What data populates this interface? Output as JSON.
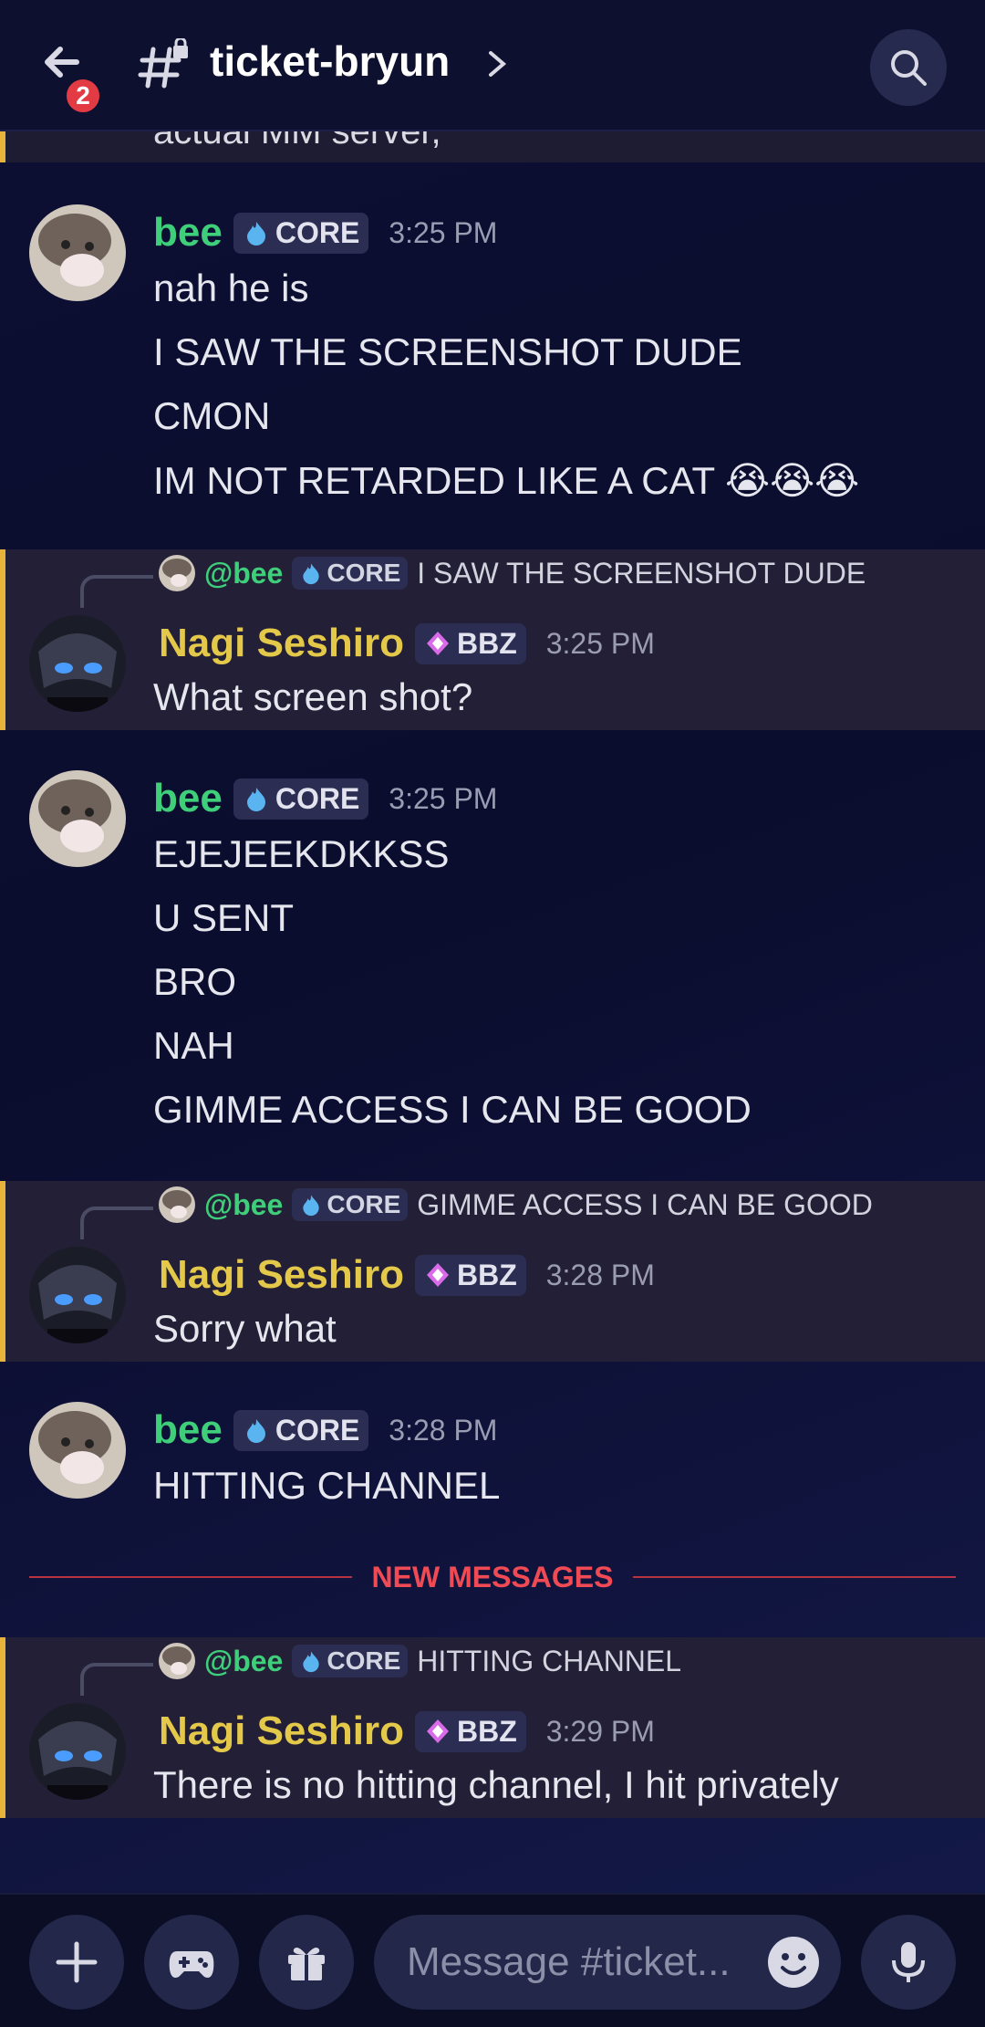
{
  "header": {
    "notif_count": "2",
    "channel_name": "ticket-bryun"
  },
  "cut_message": {
    "text": "actual MM server,"
  },
  "messages": [
    {
      "author": "bee",
      "tag": "CORE",
      "time": "3:25 PM",
      "lines": [
        "nah he is",
        "I SAW THE SCREENSHOT DUDE",
        "CMON",
        "IM NOT RETARDED LIKE A CAT 😭😭😭"
      ]
    },
    {
      "reply": {
        "mention": "@bee",
        "tag": "CORE",
        "text": "I SAW THE SCREENSHOT DUDE"
      },
      "author": "Nagi Seshiro",
      "tag": "BBZ",
      "time": "3:25 PM",
      "lines": [
        "What screen shot?"
      ]
    },
    {
      "author": "bee",
      "tag": "CORE",
      "time": "3:25 PM",
      "lines": [
        "EJEJEEKDKKSS",
        "U SENT",
        "BRO",
        "NAH",
        "GIMME ACCESS I CAN BE GOOD"
      ]
    },
    {
      "reply": {
        "mention": "@bee",
        "tag": "CORE",
        "text": "GIMME ACCESS I CAN BE GOOD"
      },
      "author": "Nagi Seshiro",
      "tag": "BBZ",
      "time": "3:28 PM",
      "lines": [
        "Sorry what"
      ]
    },
    {
      "author": "bee",
      "tag": "CORE",
      "time": "3:28 PM",
      "lines": [
        "HITTING CHANNEL"
      ]
    },
    {
      "reply": {
        "mention": "@bee",
        "tag": "CORE",
        "text": "HITTING CHANNEL"
      },
      "author": "Nagi Seshiro",
      "tag": "BBZ",
      "time": "3:29 PM",
      "lines": [
        "There is no hitting channel, I hit privately"
      ]
    }
  ],
  "divider": {
    "label": "NEW MESSAGES"
  },
  "composer": {
    "placeholder": "Message #ticket..."
  },
  "colors": {
    "accent_yellow": "#e8b33a",
    "bee_green": "#3fcf7a",
    "nagi_gold": "#e4c84a",
    "new_red": "#f04a55"
  }
}
